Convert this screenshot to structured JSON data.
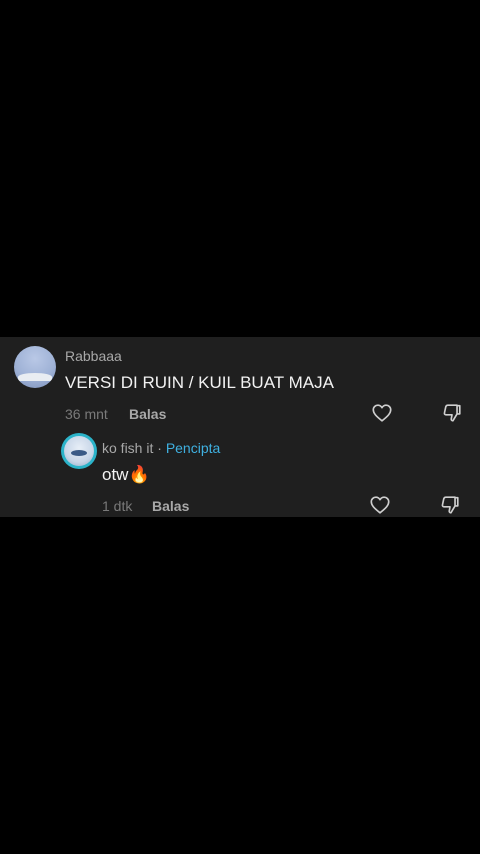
{
  "comment": {
    "username": "Rabbaaa",
    "text": "VERSI DI RUIN / KUIL BUAT MAJA",
    "time": "36 mnt",
    "reply_label": "Balas"
  },
  "reply": {
    "username": "ko fish it",
    "separator": "·",
    "creator_badge": "Pencipta",
    "text": "otw",
    "emoji": "🔥",
    "time": "1 dtk",
    "reply_label": "Balas"
  },
  "icons": {
    "like": "heart-icon",
    "dislike": "thumbs-down-icon"
  },
  "colors": {
    "background": "#000000",
    "panel": "#1f1f1f",
    "creator": "#3fb0e0"
  }
}
